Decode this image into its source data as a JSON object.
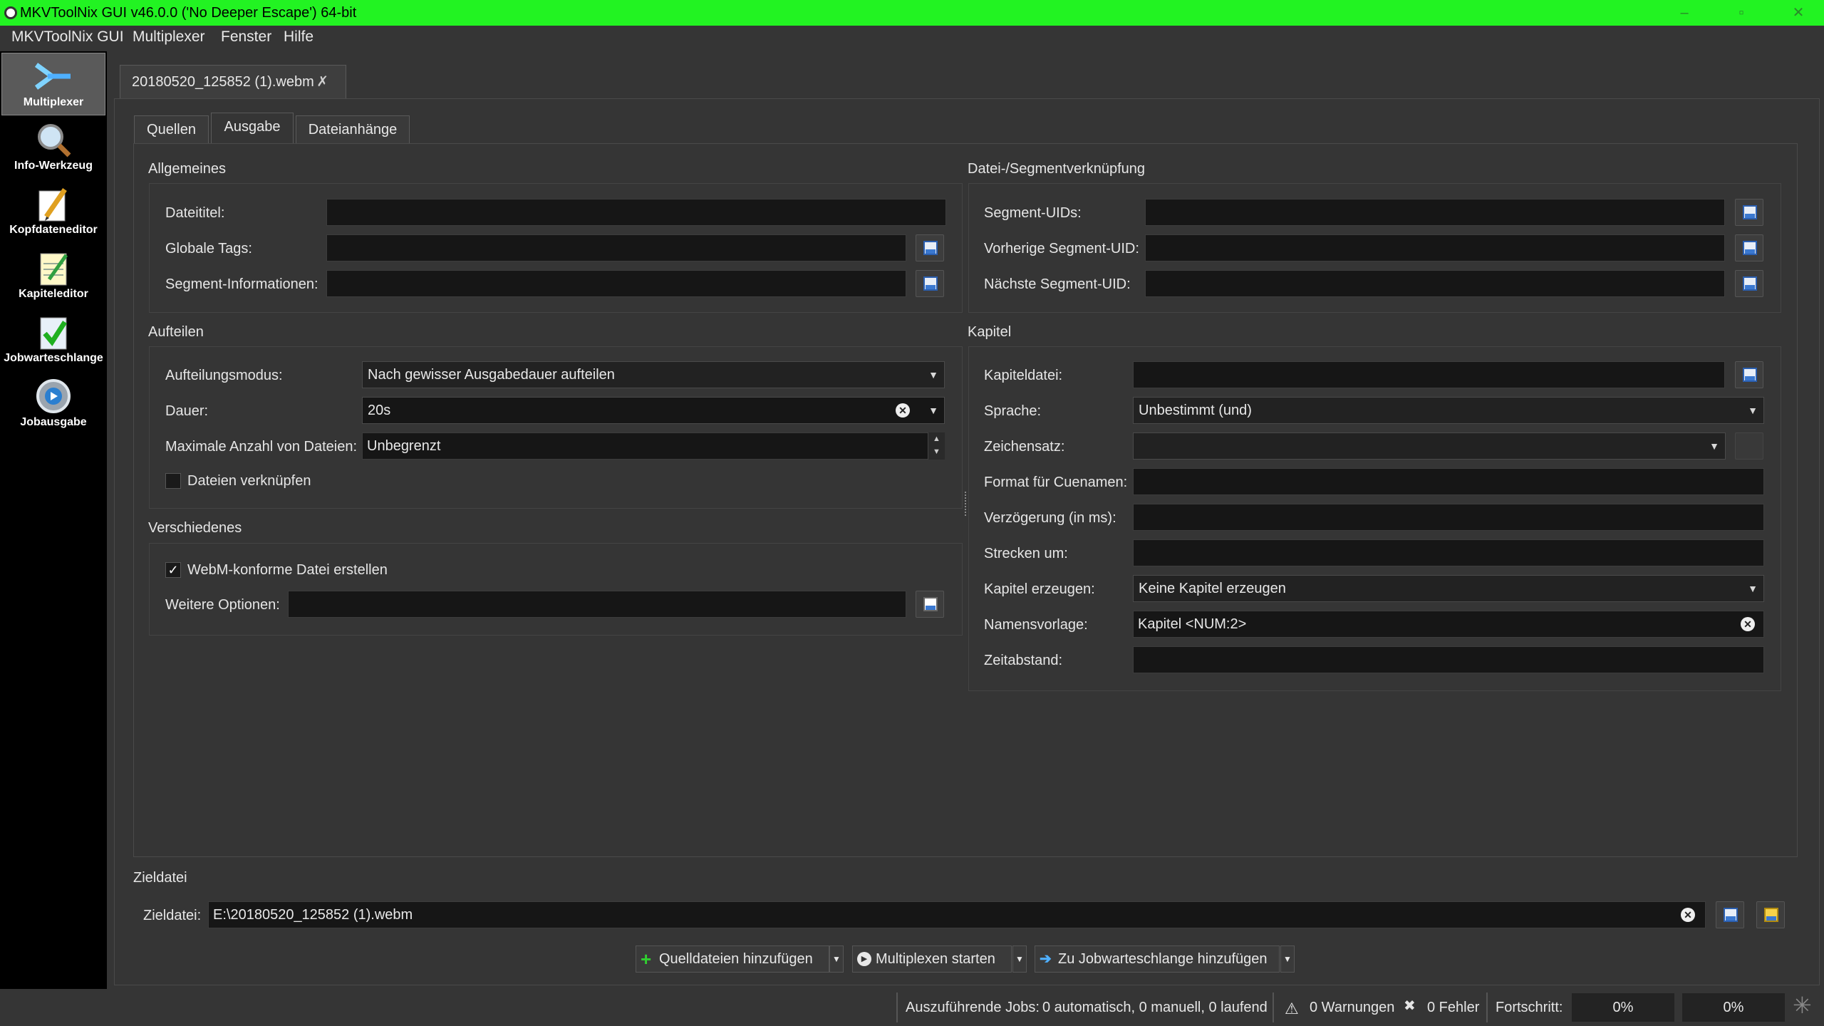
{
  "window": {
    "title": "MKVToolNix GUI v46.0.0 ('No Deeper Escape') 64-bit",
    "controls": [
      "–",
      "▫",
      "✕"
    ]
  },
  "menu": [
    "MKVToolNix GUI",
    "Multiplexer",
    "Fenster",
    "Hilfe"
  ],
  "sidebar": [
    {
      "label": "Multiplexer",
      "icon": "multiplexer-icon"
    },
    {
      "label": "Info-Werkzeug",
      "icon": "magnifier-icon"
    },
    {
      "label": "Kopfdateneditor",
      "icon": "pencil-icon"
    },
    {
      "label": "Kapiteleditor",
      "icon": "notepad-icon"
    },
    {
      "label": "Jobwarteschlange",
      "icon": "checklist-icon"
    },
    {
      "label": "Jobausgabe",
      "icon": "gear-play-icon"
    }
  ],
  "document_tab": {
    "label": "20180520_125852 (1).webm",
    "close": "✗"
  },
  "tabs": [
    "Quellen",
    "Ausgabe",
    "Dateianhänge"
  ],
  "allgemeines": {
    "title": "Allgemeines",
    "dateititel": "Dateititel:",
    "globale_tags": "Globale Tags:",
    "segment_info": "Segment-Informationen:"
  },
  "aufteilen": {
    "title": "Aufteilen",
    "modus_label": "Aufteilungsmodus:",
    "modus_value": "Nach gewisser Ausgabedauer aufteilen",
    "dauer_label": "Dauer:",
    "dauer_value": "20s",
    "max_label": "Maximale Anzahl von Dateien:",
    "max_value": "Unbegrenzt",
    "verknuepfen": "Dateien verknüpfen"
  },
  "verschiedenes": {
    "title": "Verschiedenes",
    "webm": "WebM-konforme Datei erstellen",
    "webm_checked": "✓",
    "weitere": "Weitere Optionen:"
  },
  "segment": {
    "title": "Datei-/Segmentverknüpfung",
    "uids": "Segment-UIDs:",
    "prev": "Vorherige Segment-UID:",
    "next": "Nächste Segment-UID:"
  },
  "kapitel": {
    "title": "Kapitel",
    "datei": "Kapiteldatei:",
    "sprache_label": "Sprache:",
    "sprache_value": "Unbestimmt (und)",
    "zeichensatz": "Zeichensatz:",
    "format": "Format für Cuenamen:",
    "verzoegerung": "Verzögerung (in ms):",
    "strecken": "Strecken um:",
    "erzeugen_label": "Kapitel erzeugen:",
    "erzeugen_value": "Keine Kapitel erzeugen",
    "namensvorlage_label": "Namensvorlage:",
    "namensvorlage_value": "Kapitel <NUM:2>",
    "zeitabstand": "Zeitabstand:"
  },
  "zieldatei": {
    "group": "Zieldatei",
    "label": "Zieldatei:",
    "value": "E:\\20180520_125852 (1).webm"
  },
  "buttons": {
    "add_sources": "Quelldateien hinzufügen",
    "start": "Multiplexen starten",
    "queue": "Zu Jobwarteschlange hinzufügen"
  },
  "status": {
    "jobs_label": "Auszuführende Jobs:",
    "jobs_value": "0 automatisch, 0 manuell, 0 laufend",
    "warnings": "0 Warnungen",
    "errors": "0 Fehler",
    "progress_label": "Fortschritt:",
    "progress1": "0%",
    "progress2": "0%"
  },
  "accent": "#22f322"
}
